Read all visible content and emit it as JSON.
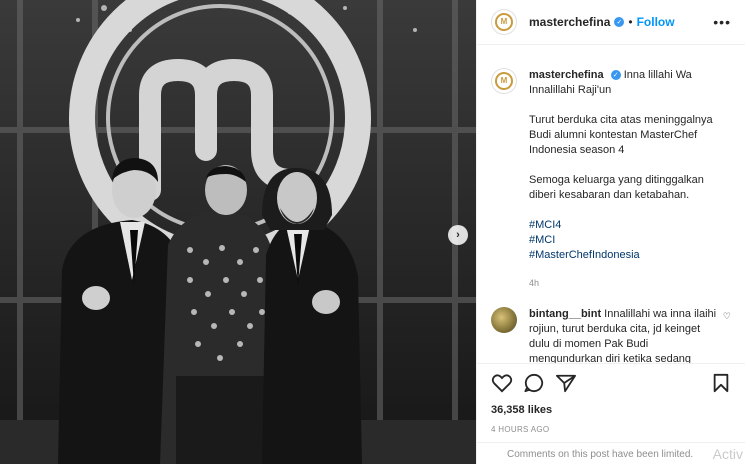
{
  "post": {
    "account": "masterchefina",
    "follow_label": "Follow",
    "more_label": "•••",
    "avatar_text": "M",
    "carousel_next": "›"
  },
  "caption": {
    "username": "masterchefina",
    "line1": "Inna lillahi Wa Innalillahi Raji'un",
    "para1": "Turut berduka cita atas meninggalnya Budi alumni kontestan MasterChef Indonesia season 4",
    "para2": "Semoga keluarga yang ditinggalkan diberi kesabaran dan ketabahan.",
    "hashtags": [
      "#MCI4",
      "#MCI",
      "#MasterChefIndonesia"
    ],
    "time": "4h"
  },
  "comment": {
    "username": "bintang__bint",
    "text": "Innalillahi wa inna ilaihi rojiun, turut berduka cita, jd keinget dulu di momen Pak Budi mengundurkan diri ketika sedang"
  },
  "stats": {
    "likes": "36,358 likes",
    "posted": "4 HOURS AGO"
  },
  "footer": {
    "limited_text": "Comments on this post have been limited.",
    "watermark": "Activ"
  },
  "icons": [
    "verified-badge-icon",
    "heart-icon",
    "comment-icon",
    "share-icon",
    "bookmark-icon",
    "chevron-right-icon"
  ],
  "colors": {
    "accent": "#0095f6",
    "verified": "#3897f0",
    "hashtag": "#00376b",
    "muted": "#8e8e8e"
  }
}
